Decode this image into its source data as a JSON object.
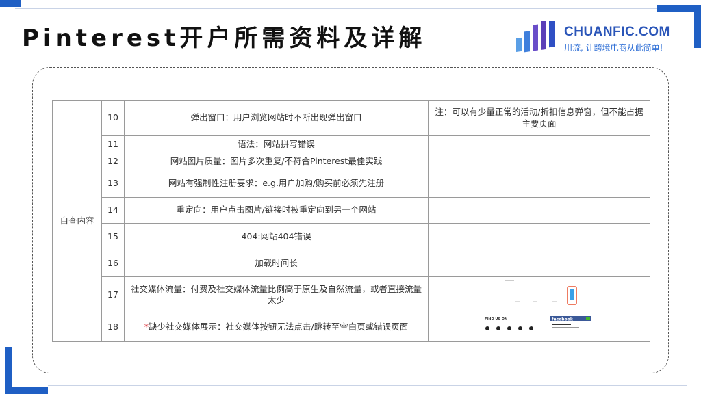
{
  "title": "Pinterest开户所需资料及详解",
  "logo": {
    "name": "CHUANFIC.COM",
    "tagline": "川流, 让跨境电商从此简单!"
  },
  "table": {
    "category": "自查内容",
    "rows": [
      {
        "num": "10",
        "desc": "弹出窗口：用户浏览网站时不断出现弹出窗口",
        "note": "注：可以有少量正常的活动/折扣信息弹窗，但不能占据主要页面"
      },
      {
        "num": "11",
        "desc": "语法：网站拼写错误",
        "note": ""
      },
      {
        "num": "12",
        "desc": "网站图片质量：图片多次重复/不符合Pinterest最佳实践",
        "note": ""
      },
      {
        "num": "13",
        "desc": "网站有强制性注册要求：e.g.用户加购/购买前必须先注册",
        "note": ""
      },
      {
        "num": "14",
        "desc": "重定向：用户点击图片/链接时被重定向到另一个网站",
        "note": ""
      },
      {
        "num": "15",
        "desc": "404:网站404错误",
        "note": ""
      },
      {
        "num": "16",
        "desc": "加载时间长",
        "note": ""
      },
      {
        "num": "17",
        "desc": "社交媒体流量：付费及社交媒体流量比例高于原生及自然流量，或者直接流量太少",
        "note": ""
      },
      {
        "num": "18",
        "desc_mark": "*",
        "desc": "缺少社交媒体展示：社交媒体按钮无法点击/跳转至空白页或错误页面",
        "note": ""
      }
    ]
  },
  "thumb18": {
    "find_us": "FIND US ON",
    "fb_label": "facebook"
  },
  "colors": {
    "accent": "#1f5fc4",
    "logo_text": "#2a55b8",
    "mark": "#d8232a"
  }
}
